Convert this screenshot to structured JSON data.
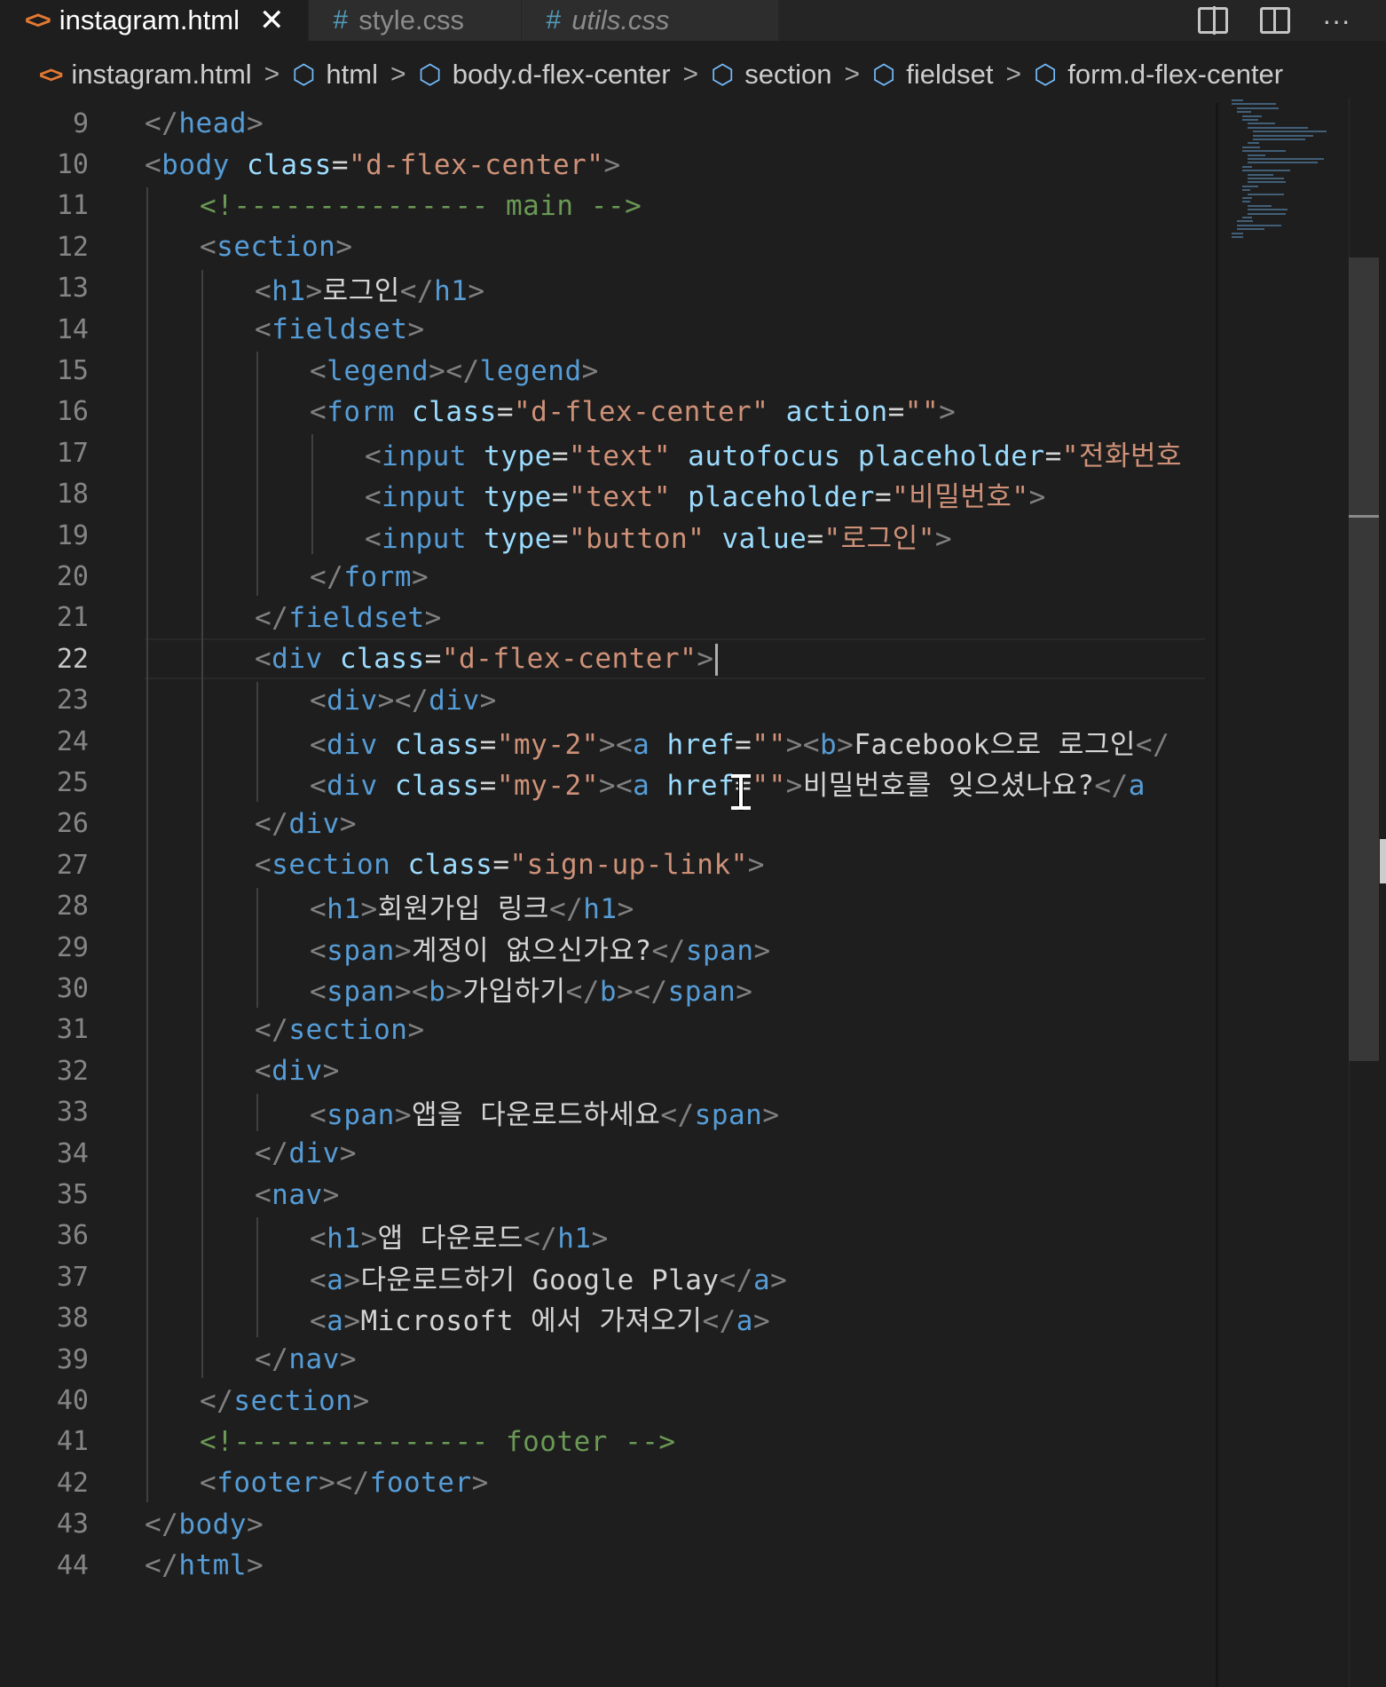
{
  "tabs": [
    {
      "label": "instagram.html",
      "icon": "html-file-icon",
      "active": true,
      "close": "✕"
    },
    {
      "label": "style.css",
      "icon": "css-file-icon",
      "active": false
    },
    {
      "label": "utils.css",
      "icon": "css-file-icon",
      "active": false
    }
  ],
  "tab_icons": {
    "html": "<>",
    "css": "#"
  },
  "actions": {
    "more": "···"
  },
  "breadcrumb": [
    "instagram.html",
    "html",
    "body.d-flex-center",
    "section",
    "fieldset",
    "form.d-flex-center"
  ],
  "breadcrumb_sep": ">",
  "editor": {
    "current_line": 22,
    "lines": [
      {
        "n": "9",
        "tokens": [
          [
            "br",
            "</"
          ],
          [
            "tag",
            "head"
          ],
          [
            "br",
            ">"
          ]
        ]
      },
      {
        "n": "10",
        "tokens": [
          [
            "br",
            "<"
          ],
          [
            "tag",
            "body"
          ],
          [
            "txt",
            " "
          ],
          [
            "attr",
            "class"
          ],
          [
            "txt",
            "="
          ],
          [
            "str",
            "\"d-flex-center\""
          ],
          [
            "br",
            ">"
          ]
        ]
      },
      {
        "n": "11",
        "tokens": [
          [
            "cmt",
            "<!--------------- main -->"
          ]
        ]
      },
      {
        "n": "12",
        "tokens": [
          [
            "br",
            "<"
          ],
          [
            "tag",
            "section"
          ],
          [
            "br",
            ">"
          ]
        ]
      },
      {
        "n": "13",
        "tokens": [
          [
            "br",
            "<"
          ],
          [
            "tag",
            "h1"
          ],
          [
            "br",
            ">"
          ],
          [
            "txt",
            "로그인"
          ],
          [
            "br",
            "</"
          ],
          [
            "tag",
            "h1"
          ],
          [
            "br",
            ">"
          ]
        ]
      },
      {
        "n": "14",
        "tokens": [
          [
            "br",
            "<"
          ],
          [
            "tag",
            "fieldset"
          ],
          [
            "br",
            ">"
          ]
        ]
      },
      {
        "n": "15",
        "tokens": [
          [
            "br",
            "<"
          ],
          [
            "tag",
            "legend"
          ],
          [
            "br",
            "></"
          ],
          [
            "tag",
            "legend"
          ],
          [
            "br",
            ">"
          ]
        ]
      },
      {
        "n": "16",
        "tokens": [
          [
            "br",
            "<"
          ],
          [
            "tag",
            "form"
          ],
          [
            "txt",
            " "
          ],
          [
            "attr",
            "class"
          ],
          [
            "txt",
            "="
          ],
          [
            "str",
            "\"d-flex-center\""
          ],
          [
            "txt",
            " "
          ],
          [
            "attr",
            "action"
          ],
          [
            "txt",
            "="
          ],
          [
            "str",
            "\"\""
          ],
          [
            "br",
            ">"
          ]
        ]
      },
      {
        "n": "17",
        "tokens": [
          [
            "br",
            "<"
          ],
          [
            "tag",
            "input"
          ],
          [
            "txt",
            " "
          ],
          [
            "attr",
            "type"
          ],
          [
            "txt",
            "="
          ],
          [
            "str",
            "\"text\""
          ],
          [
            "txt",
            " "
          ],
          [
            "attr",
            "autofocus"
          ],
          [
            "txt",
            " "
          ],
          [
            "attr",
            "placeholder"
          ],
          [
            "txt",
            "="
          ],
          [
            "str",
            "\"전화번호"
          ]
        ]
      },
      {
        "n": "18",
        "tokens": [
          [
            "br",
            "<"
          ],
          [
            "tag",
            "input"
          ],
          [
            "txt",
            " "
          ],
          [
            "attr",
            "type"
          ],
          [
            "txt",
            "="
          ],
          [
            "str",
            "\"text\""
          ],
          [
            "txt",
            " "
          ],
          [
            "attr",
            "placeholder"
          ],
          [
            "txt",
            "="
          ],
          [
            "str",
            "\"비밀번호\""
          ],
          [
            "br",
            ">"
          ]
        ]
      },
      {
        "n": "19",
        "tokens": [
          [
            "br",
            "<"
          ],
          [
            "tag",
            "input"
          ],
          [
            "txt",
            " "
          ],
          [
            "attr",
            "type"
          ],
          [
            "txt",
            "="
          ],
          [
            "str",
            "\"button\""
          ],
          [
            "txt",
            " "
          ],
          [
            "attr",
            "value"
          ],
          [
            "txt",
            "="
          ],
          [
            "str",
            "\"로그인\""
          ],
          [
            "br",
            ">"
          ]
        ]
      },
      {
        "n": "20",
        "tokens": [
          [
            "br",
            "</"
          ],
          [
            "tag",
            "form"
          ],
          [
            "br",
            ">"
          ]
        ]
      },
      {
        "n": "21",
        "tokens": [
          [
            "br",
            "</"
          ],
          [
            "tag",
            "fieldset"
          ],
          [
            "br",
            ">"
          ]
        ]
      },
      {
        "n": "22",
        "tokens": [
          [
            "br",
            "<"
          ],
          [
            "tag",
            "div"
          ],
          [
            "txt",
            " "
          ],
          [
            "attr",
            "class"
          ],
          [
            "txt",
            "="
          ],
          [
            "str",
            "\"d-flex-center\""
          ],
          [
            "br",
            ">"
          ]
        ]
      },
      {
        "n": "23",
        "tokens": [
          [
            "br",
            "<"
          ],
          [
            "tag",
            "div"
          ],
          [
            "br",
            "></"
          ],
          [
            "tag",
            "div"
          ],
          [
            "br",
            ">"
          ]
        ]
      },
      {
        "n": "24",
        "tokens": [
          [
            "br",
            "<"
          ],
          [
            "tag",
            "div"
          ],
          [
            "txt",
            " "
          ],
          [
            "attr",
            "class"
          ],
          [
            "txt",
            "="
          ],
          [
            "str",
            "\"my-2\""
          ],
          [
            "br",
            "><"
          ],
          [
            "tag",
            "a"
          ],
          [
            "txt",
            " "
          ],
          [
            "attr",
            "href"
          ],
          [
            "txt",
            "="
          ],
          [
            "str",
            "\"\""
          ],
          [
            "br",
            "><"
          ],
          [
            "tag",
            "b"
          ],
          [
            "br",
            ">"
          ],
          [
            "txt",
            "Facebook으로 로그인"
          ],
          [
            "br",
            "</"
          ]
        ]
      },
      {
        "n": "25",
        "tokens": [
          [
            "br",
            "<"
          ],
          [
            "tag",
            "div"
          ],
          [
            "txt",
            " "
          ],
          [
            "attr",
            "class"
          ],
          [
            "txt",
            "="
          ],
          [
            "str",
            "\"my-2\""
          ],
          [
            "br",
            "><"
          ],
          [
            "tag",
            "a"
          ],
          [
            "txt",
            " "
          ],
          [
            "attr",
            "href"
          ],
          [
            "txt",
            "="
          ],
          [
            "str",
            "\"\""
          ],
          [
            "br",
            ">"
          ],
          [
            "txt",
            "비밀번호를 잊으셨나요?"
          ],
          [
            "br",
            "</"
          ],
          [
            "tag",
            "a"
          ]
        ]
      },
      {
        "n": "26",
        "tokens": [
          [
            "br",
            "</"
          ],
          [
            "tag",
            "div"
          ],
          [
            "br",
            ">"
          ]
        ]
      },
      {
        "n": "27",
        "tokens": [
          [
            "br",
            "<"
          ],
          [
            "tag",
            "section"
          ],
          [
            "txt",
            " "
          ],
          [
            "attr",
            "class"
          ],
          [
            "txt",
            "="
          ],
          [
            "str",
            "\"sign-up-link\""
          ],
          [
            "br",
            ">"
          ]
        ]
      },
      {
        "n": "28",
        "tokens": [
          [
            "br",
            "<"
          ],
          [
            "tag",
            "h1"
          ],
          [
            "br",
            ">"
          ],
          [
            "txt",
            "회원가입 링크"
          ],
          [
            "br",
            "</"
          ],
          [
            "tag",
            "h1"
          ],
          [
            "br",
            ">"
          ]
        ]
      },
      {
        "n": "29",
        "tokens": [
          [
            "br",
            "<"
          ],
          [
            "tag",
            "span"
          ],
          [
            "br",
            ">"
          ],
          [
            "txt",
            "계정이 없으신가요?"
          ],
          [
            "br",
            "</"
          ],
          [
            "tag",
            "span"
          ],
          [
            "br",
            ">"
          ]
        ]
      },
      {
        "n": "30",
        "tokens": [
          [
            "br",
            "<"
          ],
          [
            "tag",
            "span"
          ],
          [
            "br",
            "><"
          ],
          [
            "tag",
            "b"
          ],
          [
            "br",
            ">"
          ],
          [
            "txt",
            "가입하기"
          ],
          [
            "br",
            "</"
          ],
          [
            "tag",
            "b"
          ],
          [
            "br",
            "></"
          ],
          [
            "tag",
            "span"
          ],
          [
            "br",
            ">"
          ]
        ]
      },
      {
        "n": "31",
        "tokens": [
          [
            "br",
            "</"
          ],
          [
            "tag",
            "section"
          ],
          [
            "br",
            ">"
          ]
        ]
      },
      {
        "n": "32",
        "tokens": [
          [
            "br",
            "<"
          ],
          [
            "tag",
            "div"
          ],
          [
            "br",
            ">"
          ]
        ]
      },
      {
        "n": "33",
        "tokens": [
          [
            "br",
            "<"
          ],
          [
            "tag",
            "span"
          ],
          [
            "br",
            ">"
          ],
          [
            "txt",
            "앱을 다운로드하세요"
          ],
          [
            "br",
            "</"
          ],
          [
            "tag",
            "span"
          ],
          [
            "br",
            ">"
          ]
        ]
      },
      {
        "n": "34",
        "tokens": [
          [
            "br",
            "</"
          ],
          [
            "tag",
            "div"
          ],
          [
            "br",
            ">"
          ]
        ]
      },
      {
        "n": "35",
        "tokens": [
          [
            "br",
            "<"
          ],
          [
            "tag",
            "nav"
          ],
          [
            "br",
            ">"
          ]
        ]
      },
      {
        "n": "36",
        "tokens": [
          [
            "br",
            "<"
          ],
          [
            "tag",
            "h1"
          ],
          [
            "br",
            ">"
          ],
          [
            "txt",
            "앱 다운로드"
          ],
          [
            "br",
            "</"
          ],
          [
            "tag",
            "h1"
          ],
          [
            "br",
            ">"
          ]
        ]
      },
      {
        "n": "37",
        "tokens": [
          [
            "br",
            "<"
          ],
          [
            "tag",
            "a"
          ],
          [
            "br",
            ">"
          ],
          [
            "txt",
            "다운로드하기 Google Play"
          ],
          [
            "br",
            "</"
          ],
          [
            "tag",
            "a"
          ],
          [
            "br",
            ">"
          ]
        ]
      },
      {
        "n": "38",
        "tokens": [
          [
            "br",
            "<"
          ],
          [
            "tag",
            "a"
          ],
          [
            "br",
            ">"
          ],
          [
            "txt",
            "Microsoft 에서 가져오기"
          ],
          [
            "br",
            "</"
          ],
          [
            "tag",
            "a"
          ],
          [
            "br",
            ">"
          ]
        ]
      },
      {
        "n": "39",
        "tokens": [
          [
            "br",
            "</"
          ],
          [
            "tag",
            "nav"
          ],
          [
            "br",
            ">"
          ]
        ]
      },
      {
        "n": "40",
        "tokens": [
          [
            "br",
            "</"
          ],
          [
            "tag",
            "section"
          ],
          [
            "br",
            ">"
          ]
        ]
      },
      {
        "n": "41",
        "tokens": [
          [
            "cmt",
            "<!--------------- footer -->"
          ]
        ]
      },
      {
        "n": "42",
        "tokens": [
          [
            "br",
            "<"
          ],
          [
            "tag",
            "footer"
          ],
          [
            "br",
            "></"
          ],
          [
            "tag",
            "footer"
          ],
          [
            "br",
            ">"
          ]
        ]
      },
      {
        "n": "43",
        "tokens": [
          [
            "br",
            "</"
          ],
          [
            "tag",
            "body"
          ],
          [
            "br",
            ">"
          ]
        ]
      },
      {
        "n": "44",
        "tokens": [
          [
            "br",
            "</"
          ],
          [
            "tag",
            "html"
          ],
          [
            "br",
            ">"
          ]
        ]
      }
    ]
  }
}
